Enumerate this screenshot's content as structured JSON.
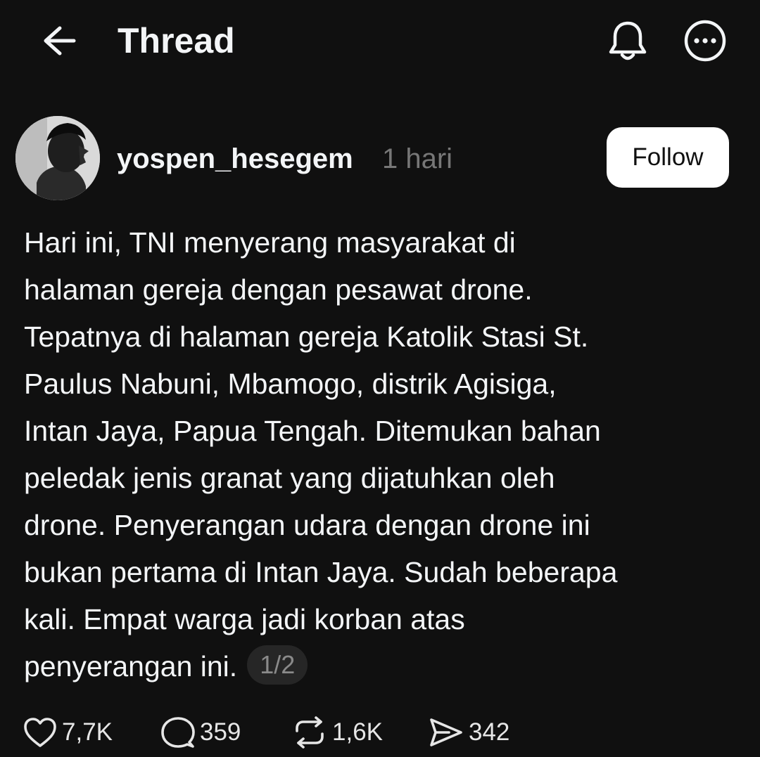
{
  "header": {
    "title": "Thread",
    "back_icon": "arrow-left-icon",
    "notify_icon": "bell-icon",
    "more_icon": "more-circle-icon"
  },
  "author": {
    "username": "yospen_hesegem",
    "timestamp": "1 hari",
    "follow_label": "Follow"
  },
  "post": {
    "lines": [
      "Hari ini, TNI menyerang masyarakat di",
      "halaman gereja dengan pesawat drone.",
      "Tepatnya di halaman gereja Katolik Stasi St.",
      "Paulus Nabuni, Mbamogo, distrik Agisiga,",
      "Intan Jaya, Papua Tengah. Ditemukan bahan",
      "peledak jenis granat yang dijatuhkan oleh",
      "drone. Penyerangan udara dengan drone ini",
      "bukan pertama di Intan Jaya. Sudah beberapa",
      "kali. Empat warga jadi korban atas",
      "penyerangan ini."
    ],
    "thread_position": "1/2"
  },
  "actions": {
    "likes": "7,7K",
    "replies": "359",
    "reposts": "1,6K",
    "shares": "342"
  },
  "colors": {
    "background": "#101010",
    "text": "#f3f5f7",
    "muted": "#777777",
    "follow_bg": "#ffffff"
  }
}
